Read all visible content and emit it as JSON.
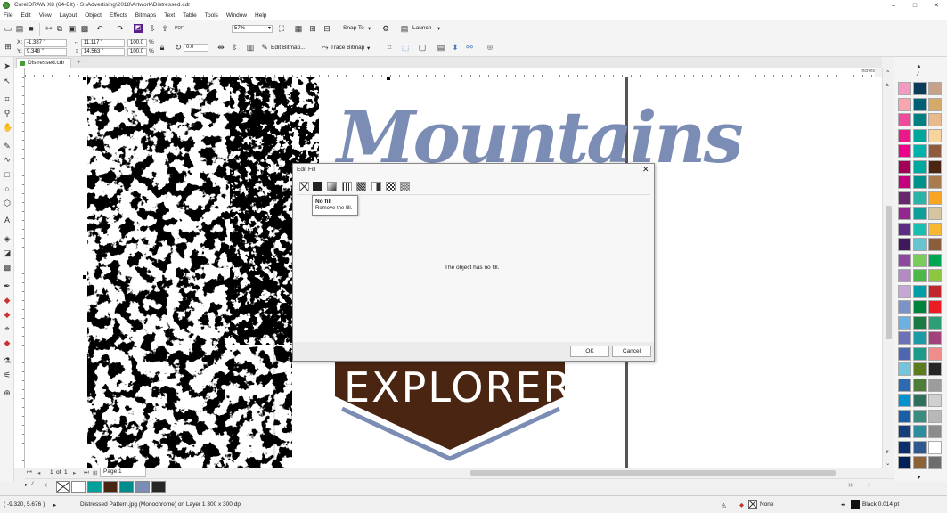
{
  "titlebar": {
    "title": "CorelDRAW X8 (64-Bit) - S:\\Advertising\\2018\\Artwork\\Distressed.cdr",
    "minimize": "–",
    "maximize": "□",
    "close": "✕"
  },
  "menu": [
    "File",
    "Edit",
    "View",
    "Layout",
    "Object",
    "Effects",
    "Bitmaps",
    "Text",
    "Table",
    "Tools",
    "Window",
    "Help"
  ],
  "toolbar": {
    "zoom": "57%",
    "snap_to": "Snap To",
    "launch": "Launch"
  },
  "propbar": {
    "x_label": "X:",
    "x_value": "-1.387 \"",
    "y_label": "Y:",
    "y_value": "9.348 \"",
    "width_value": "11.117 \"",
    "height_value": "14.563 \"",
    "scale_x": "100.0",
    "scale_y": "100.0",
    "pct": "%",
    "rotation": "0.0",
    "edit_bitmap": "Edit Bitmap...",
    "trace_bitmap": "Trace Bitmap"
  },
  "doc_tab": {
    "name": "Distressed.cdr",
    "add": "+"
  },
  "ruler": {
    "units": "inches"
  },
  "artwork": {
    "word_top": "Mountains",
    "word_bottom": "EXPLORER",
    "brown": "#4a2511",
    "blue": "#7b8db4"
  },
  "pages": {
    "current": "1",
    "of_label": "of",
    "total": "1",
    "tab": "Page 1"
  },
  "dialog": {
    "title": "Edit Fill",
    "tooltip_title": "No fill",
    "tooltip_desc": "Remove the fill.",
    "message": "The object has no fill.",
    "ok": "OK",
    "cancel": "Cancel"
  },
  "palette_colors": [
    "#f49ac1",
    "#0c3a59",
    "#c7a188",
    "#f7a6b0",
    "#006073",
    "#d4a96a",
    "#ee4c9a",
    "#008080",
    "#e8b98c",
    "#ed178c",
    "#00a79d",
    "#f8d49c",
    "#ec008c",
    "#00b2a9",
    "#8e5b3e",
    "#a3005a",
    "#00a99d",
    "#4a2511",
    "#c4007c",
    "#00928a",
    "#a97c50",
    "#67286e",
    "#2bb3a7",
    "#f6a623",
    "#92278f",
    "#0f9e98",
    "#d6c5a1",
    "#5b2c82",
    "#1bbfb0",
    "#f7b731",
    "#3e1a5c",
    "#68c4d0",
    "#8b5e3c",
    "#8e4a9f",
    "#79cc57",
    "#00a651",
    "#b48ac3",
    "#4cb848",
    "#8dc63f",
    "#c6a6d4",
    "#009da4",
    "#c1272d",
    "#7b93c7",
    "#00843d",
    "#ed1c24",
    "#6cb1e1",
    "#1b7a42",
    "#2e9e76",
    "#6d72b8",
    "#1c9ba5",
    "#a3417d",
    "#4f67b1",
    "#1d9a8a",
    "#f08c89",
    "#73c5de",
    "#5c7b1f",
    "#262626",
    "#2e6aaf",
    "#4e7d3a",
    "#9c9c9c",
    "#0093d0",
    "#2f6f5e",
    "#d0d0d0",
    "#1a5fa8",
    "#3a8a7e",
    "#b8b8b8",
    "#163c7c",
    "#2d8b9e",
    "#8c8c8c",
    "#0b2f6e",
    "#305a8f",
    "#ffffff",
    "#002157",
    "#8c6239",
    "#6d6d6d"
  ],
  "recent_colors": [
    "#ffffff",
    "#00a19a",
    "#4a2511",
    "#008c8c",
    "#7b8db4",
    "#262626"
  ],
  "status": {
    "coords": "( -9.320, 5.676 )",
    "object_info": "Distressed Pattern.jpg (Monochrome) on Layer 1 300 x 300 dpi",
    "fill": "None",
    "outline": "Black  0.014 pt"
  }
}
